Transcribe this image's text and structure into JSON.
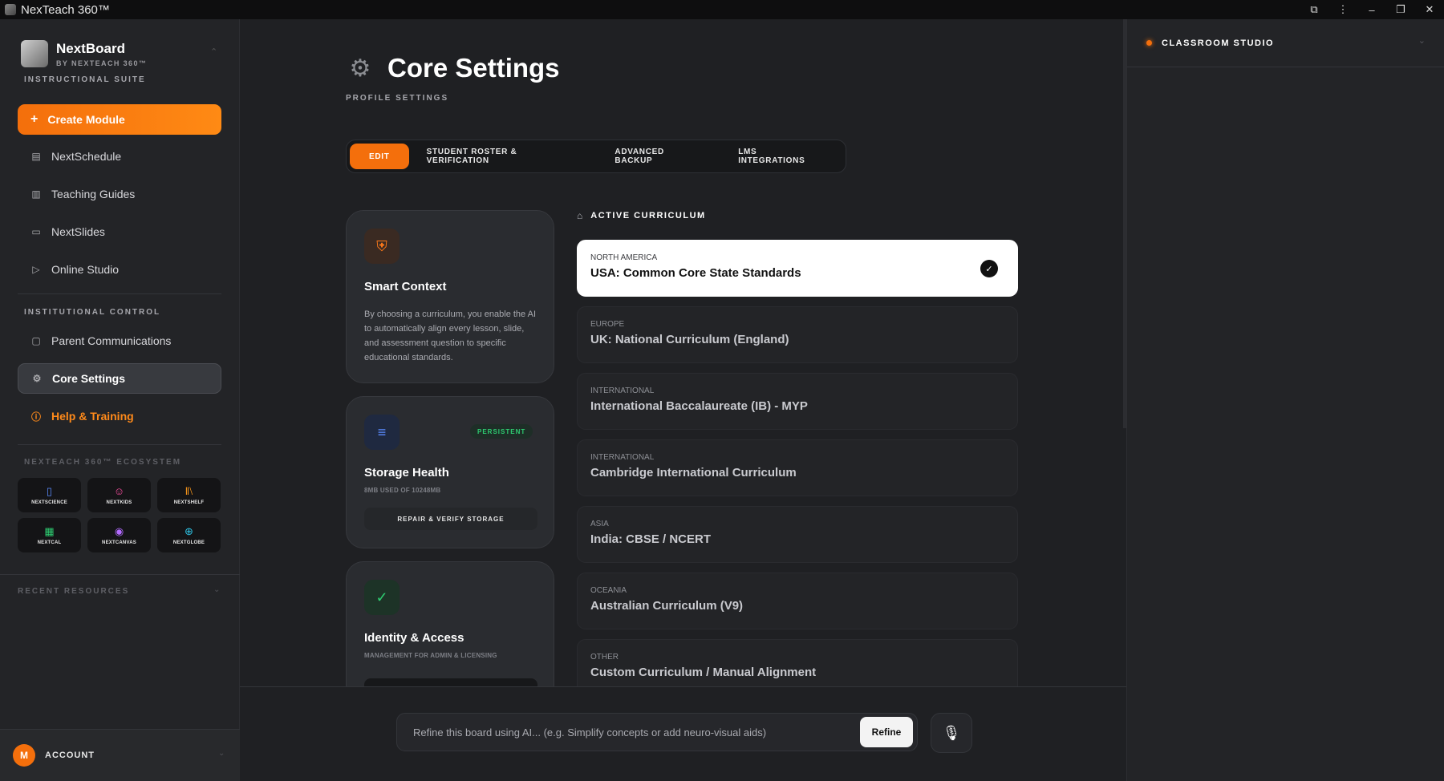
{
  "window": {
    "title": "NexTeach 360™"
  },
  "sidebar": {
    "brand": {
      "name": "NextBoard",
      "subtitle": "BY NEXTEACH 360™"
    },
    "section_instructional": "INSTRUCTIONAL SUITE",
    "create_label": "Create Module",
    "nav": [
      {
        "label": "NextSchedule",
        "icon": "calendar-icon"
      },
      {
        "label": "Teaching Guides",
        "icon": "book-icon"
      },
      {
        "label": "NextSlides",
        "icon": "presentation-icon"
      },
      {
        "label": "Online Studio",
        "icon": "video-icon"
      }
    ],
    "section_institutional": "INSTITUTIONAL CONTROL",
    "nav2": [
      {
        "label": "Parent Communications",
        "icon": "message-icon"
      },
      {
        "label": "Core Settings",
        "icon": "gear-icon"
      },
      {
        "label": "Help & Training",
        "icon": "help-icon"
      }
    ],
    "section_ecosystem": "NEXTEACH 360™ ECOSYSTEM",
    "ecosystem": [
      {
        "label": "NEXTSCIENCE",
        "icon": "flask-icon",
        "color": "#5b8cff"
      },
      {
        "label": "NEXTKIDS",
        "icon": "smile-icon",
        "color": "#ff4fa3"
      },
      {
        "label": "NEXTSHELF",
        "icon": "library-icon",
        "color": "#ff9a1a"
      },
      {
        "label": "NEXTCAL",
        "icon": "calculator-icon",
        "color": "#2ecc71"
      },
      {
        "label": "NEXTCANVAS",
        "icon": "palette-icon",
        "color": "#b36bff"
      },
      {
        "label": "NEXTGLOBE",
        "icon": "globe-icon",
        "color": "#2ec4e6"
      }
    ],
    "recent_label": "RECENT RESOURCES",
    "account": {
      "initial": "M",
      "label": "ACCOUNT"
    }
  },
  "main": {
    "title": "Core Settings",
    "subtitle": "PROFILE SETTINGS",
    "tabs": [
      "EDIT",
      "STUDENT ROSTER & VERIFICATION",
      "ADVANCED BACKUP",
      "LMS INTEGRATIONS"
    ],
    "cards": {
      "smart_context": {
        "title": "Smart Context",
        "body": "By choosing a curriculum, you enable the AI to automatically align every lesson, slide, and assessment question to specific educational standards."
      },
      "storage": {
        "title": "Storage Health",
        "badge": "PERSISTENT",
        "usage": "8MB USED OF 10248MB",
        "button": "REPAIR & VERIFY STORAGE"
      },
      "identity": {
        "title": "Identity & Access",
        "sub": "MANAGEMENT FOR ADMIN & LICENSING"
      }
    },
    "curriculum_heading": "ACTIVE CURRICULUM",
    "curricula": [
      {
        "region": "NORTH AMERICA",
        "name": "USA: Common Core State Standards",
        "selected": true
      },
      {
        "region": "EUROPE",
        "name": "UK: National Curriculum (England)",
        "selected": false
      },
      {
        "region": "INTERNATIONAL",
        "name": "International Baccalaureate (IB) - MYP",
        "selected": false
      },
      {
        "region": "INTERNATIONAL",
        "name": "Cambridge International Curriculum",
        "selected": false
      },
      {
        "region": "ASIA",
        "name": "India: CBSE / NCERT",
        "selected": false
      },
      {
        "region": "OCEANIA",
        "name": "Australian Curriculum (V9)",
        "selected": false
      },
      {
        "region": "OTHER",
        "name": "Custom Curriculum / Manual Alignment",
        "selected": false
      }
    ],
    "refine": {
      "placeholder": "Refine this board using AI... (e.g. Simplify concepts or add neuro-visual aids)",
      "button": "Refine"
    }
  },
  "right_panel": {
    "title": "CLASSROOM STUDIO"
  },
  "colors": {
    "accent": "#f46f0c",
    "persistent": "#2ecc71"
  }
}
